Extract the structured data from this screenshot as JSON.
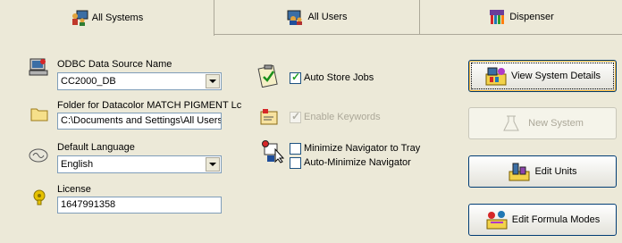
{
  "tabs": [
    {
      "label": "All Systems",
      "accel": "S",
      "active": true,
      "icon": "people-computer-icon"
    },
    {
      "label": "All Users",
      "accel": "U",
      "active": false,
      "icon": "users-icon"
    },
    {
      "label": "Dispenser",
      "accel": "",
      "active": false,
      "icon": "dispenser-icon"
    }
  ],
  "odbc": {
    "label": "ODBC Data Source Name",
    "value": "CC2000_DB"
  },
  "folder": {
    "label": "Folder for Datacolor MATCH PIGMENT Lc",
    "value": "C:\\Documents and Settings\\All Users\\A"
  },
  "language": {
    "label": "Default Language",
    "value": "English"
  },
  "license": {
    "label": "License",
    "value": "1647991358"
  },
  "options": {
    "auto_store_jobs": {
      "label": "Auto Store Jobs",
      "checked": true,
      "enabled": true
    },
    "enable_keywords": {
      "label": "Enable Keywords",
      "checked": true,
      "enabled": false
    },
    "minimize_tray": {
      "label": "Minimize Navigator to Tray",
      "checked": false,
      "enabled": true
    },
    "auto_minimize": {
      "label": "Auto-Minimize Navigator",
      "checked": false,
      "enabled": true
    }
  },
  "buttons": {
    "view_details": "View System Details",
    "new_system": "New System",
    "edit_units": "Edit Units",
    "edit_formula_modes": "Edit Formula Modes"
  }
}
